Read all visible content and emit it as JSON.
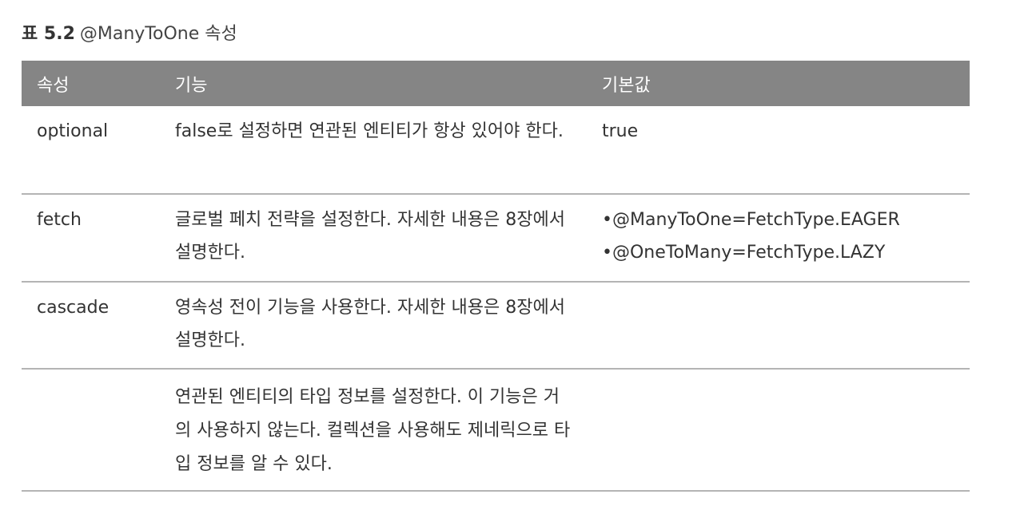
{
  "caption": {
    "number": "표 5.2",
    "title": "@ManyToOne 속성"
  },
  "table": {
    "headers": [
      "속성",
      "기능",
      "기본값"
    ],
    "rows": [
      {
        "attribute": "optional",
        "description": "false로 설정하면 연관된 엔티티가 항상 있어야 한다.",
        "default": [
          "true"
        ]
      },
      {
        "attribute": "fetch",
        "description": "글로벌 페치 전략을 설정한다. 자세한 내용은 8장에서 설명한다.",
        "default": [
          "•@ManyToOne=FetchType.EAGER",
          "•@OneToMany=FetchType.LAZY"
        ]
      },
      {
        "attribute": "cascade",
        "description": "영속성 전이 기능을 사용한다. 자세한 내용은 8장에서 설명한다.",
        "default": []
      },
      {
        "attribute": "",
        "description": "연관된 엔티티의 타입 정보를 설정한다. 이 기능은 거의 사용하지 않는다. 컬렉션을 사용해도 제네릭으로 타입 정보를 알 수 있다.",
        "default": []
      }
    ]
  }
}
